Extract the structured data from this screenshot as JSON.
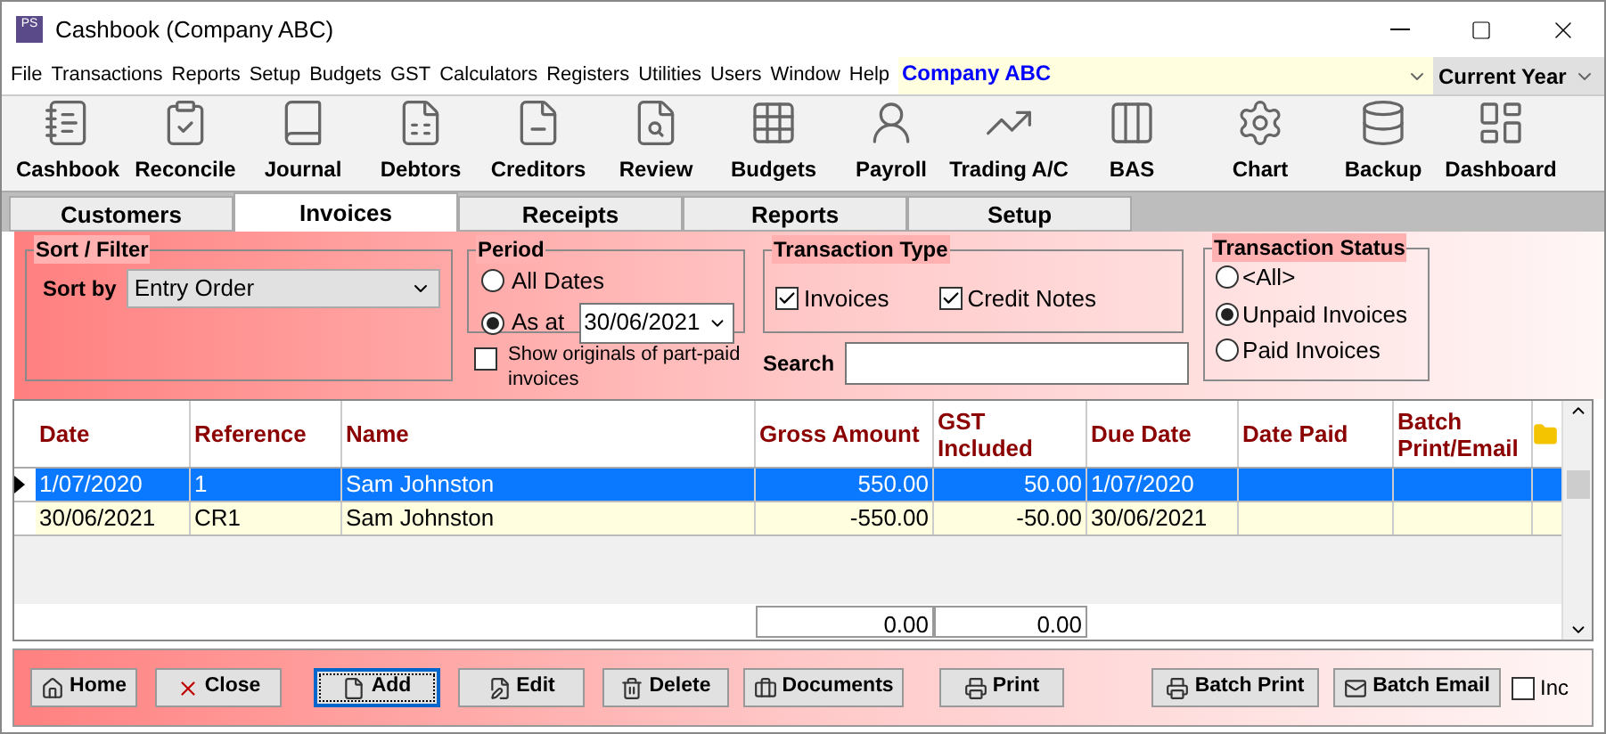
{
  "window": {
    "title": "Cashbook (Company ABC)",
    "app_badge": "PS"
  },
  "menu": [
    "File",
    "Transactions",
    "Reports",
    "Setup",
    "Budgets",
    "GST",
    "Calculators",
    "Registers",
    "Utilities",
    "Users",
    "Window",
    "Help"
  ],
  "company": "Company ABC",
  "year": "Current Year",
  "toolbar": [
    "Cashbook",
    "Reconcile",
    "Journal",
    "Debtors",
    "Creditors",
    "Review",
    "Budgets",
    "Payroll",
    "Trading A/C",
    "BAS",
    "Chart",
    "Backup",
    "Dashboard"
  ],
  "tabs": [
    {
      "label": "Customers",
      "selected": false
    },
    {
      "label": "Invoices",
      "selected": true
    },
    {
      "label": "Receipts",
      "selected": false
    },
    {
      "label": "Reports",
      "selected": false
    },
    {
      "label": "Setup",
      "selected": false
    }
  ],
  "sort_filter": {
    "title": "Sort / Filter",
    "label": "Sort by",
    "value": "Entry Order"
  },
  "period": {
    "title": "Period",
    "options": [
      {
        "label": "All Dates",
        "selected": false
      },
      {
        "label": "As at",
        "selected": true
      }
    ],
    "date": "30/06/2021"
  },
  "show_originals": {
    "label": "Show originals of part-paid invoices",
    "checked": false
  },
  "transaction_type": {
    "title": "Transaction Type",
    "options": [
      {
        "label": "Invoices",
        "checked": true
      },
      {
        "label": "Credit Notes",
        "checked": true
      }
    ]
  },
  "search": {
    "label": "Search"
  },
  "transaction_status": {
    "title": "Transaction Status",
    "options": [
      {
        "label": "<All>",
        "selected": false
      },
      {
        "label": "Unpaid Invoices",
        "selected": true
      },
      {
        "label": "Paid Invoices",
        "selected": false
      }
    ]
  },
  "table": {
    "columns": [
      "Date",
      "Reference",
      "Name",
      "Gross Amount",
      "GST Included",
      "Due Date",
      "Date Paid",
      "Batch Print/Email"
    ],
    "rows": [
      {
        "selected": true,
        "cells": [
          "1/07/2020",
          "1",
          "Sam Johnston",
          "550.00",
          "50.00",
          "1/07/2020",
          "",
          ""
        ]
      },
      {
        "selected": false,
        "cells": [
          "30/06/2021",
          "CR1",
          "Sam Johnston",
          "-550.00",
          "-50.00",
          "30/06/2021",
          "",
          ""
        ]
      }
    ],
    "totals": [
      "0.00",
      "0.00"
    ]
  },
  "buttons": [
    {
      "label": "Home",
      "focused": false
    },
    {
      "label": "Close",
      "focused": false
    },
    {
      "label": "Add",
      "focused": true
    },
    {
      "label": "Edit",
      "focused": false
    },
    {
      "label": "Delete",
      "focused": false
    },
    {
      "label": "Documents",
      "focused": false
    },
    {
      "label": "Print",
      "focused": false
    },
    {
      "label": "Batch Print",
      "focused": false
    },
    {
      "label": "Batch Email",
      "focused": false
    }
  ],
  "include": {
    "label": "Inc",
    "checked": false
  }
}
